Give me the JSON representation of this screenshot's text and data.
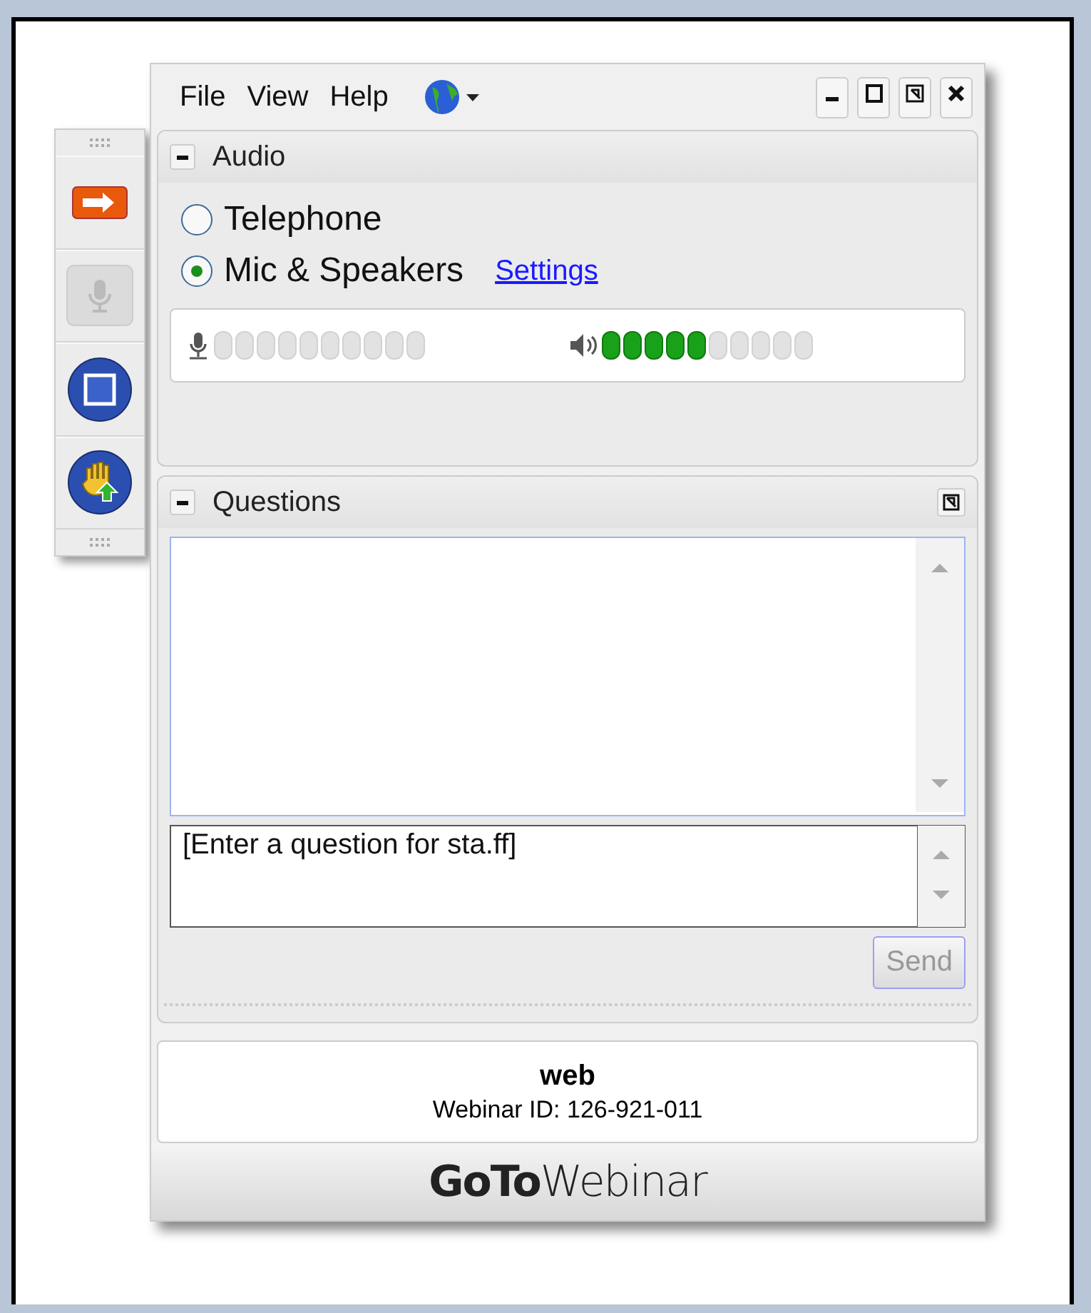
{
  "menu": [
    "File",
    "View",
    "Help"
  ],
  "toolbar": [
    {
      "kind": "arrow",
      "disabled": false
    },
    {
      "kind": "mic",
      "disabled": true
    },
    {
      "kind": "screen",
      "disabled": false
    },
    {
      "kind": "hand",
      "disabled": false
    }
  ],
  "audio": {
    "title": "Audio",
    "options": [
      {
        "label": "Telephone",
        "selected": false
      },
      {
        "label": "Mic & Speakers",
        "selected": true
      }
    ],
    "settings_link": "Settings",
    "speaker": {
      "level": 0.5
    }
  },
  "questions": {
    "title": "Questions",
    "placeholder": "[Enter a question for sta.ff]",
    "send": {
      "label": "Send",
      "disabled": true
    }
  },
  "footer": {
    "title": "web",
    "webinar_id": "Webinar ID: 126-921-011",
    "logo": "**GoTo**Webinar"
  }
}
